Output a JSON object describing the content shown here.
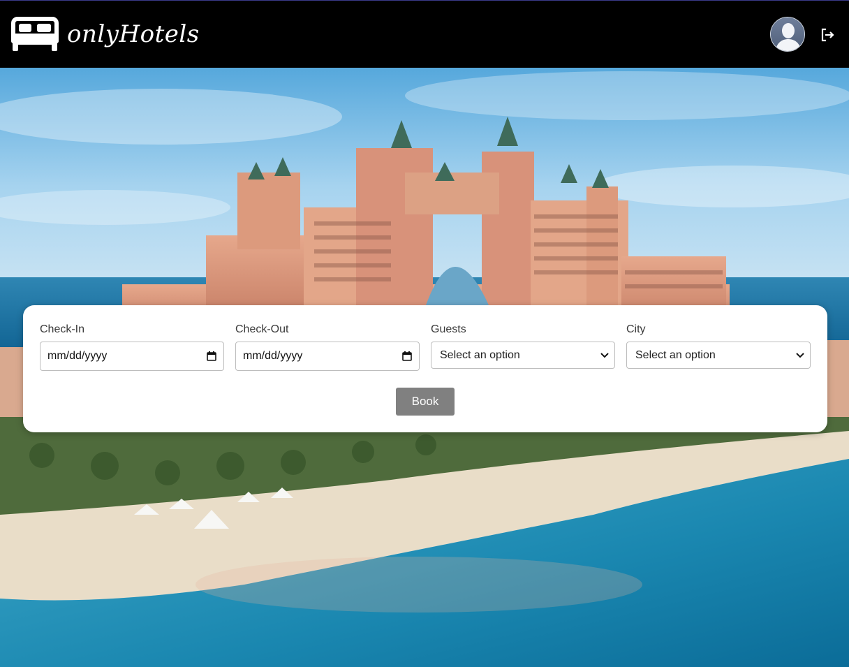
{
  "header": {
    "brand": "onlyHotels",
    "logo_icon": "bed-icon",
    "avatar_icon": "user-avatar-icon",
    "logout_icon": "logout-icon"
  },
  "hero": {
    "image_icon": "resort-photo"
  },
  "booking": {
    "checkin_label": "Check-In",
    "checkin_placeholder": "mm/dd/yyyy",
    "checkout_label": "Check-Out",
    "checkout_placeholder": "mm/dd/yyyy",
    "guests_label": "Guests",
    "guests_value": "Select an option",
    "city_label": "City",
    "city_value": "Select an option",
    "book_label": "Book",
    "calendar_icon": "calendar-icon",
    "dropdown_icon": "chevron-down-icon"
  },
  "colors": {
    "header_bg": "#000000",
    "button_bg": "#808080",
    "card_bg": "#ffffff"
  }
}
